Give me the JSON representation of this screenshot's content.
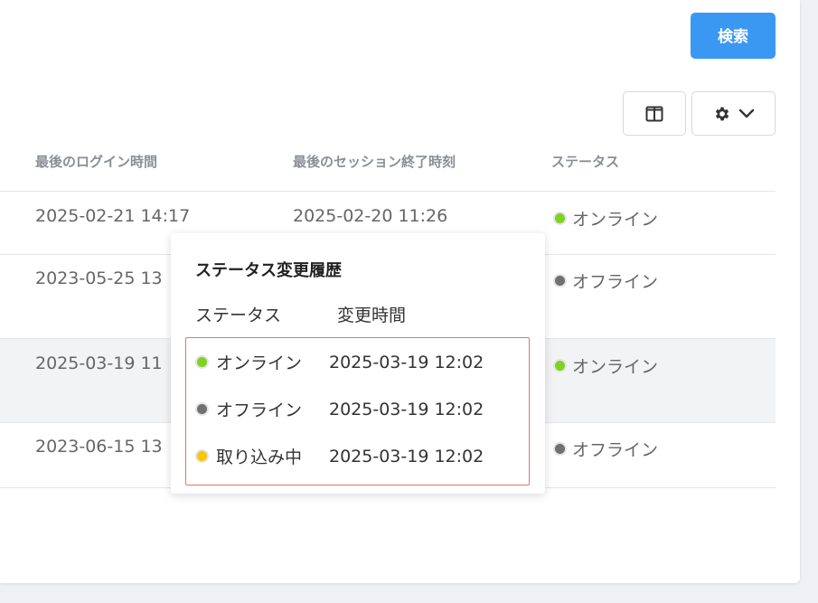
{
  "toolbar": {
    "search_label": "検索"
  },
  "table": {
    "headers": {
      "last_login": "最後のログイン時間",
      "last_session_end": "最後のセッション終了時刻",
      "status": "ステータス"
    },
    "rows": [
      {
        "last_login": "2025-02-21 14:17",
        "last_session_end": "2025-02-20 11:26",
        "status": "オンライン",
        "status_kind": "online"
      },
      {
        "last_login": "2023-05-25 13",
        "last_session_end": "",
        "status": "オフライン",
        "status_kind": "offline"
      },
      {
        "last_login": "2025-03-19 11",
        "last_session_end": "",
        "status": "オンライン",
        "status_kind": "online"
      },
      {
        "last_login": "2023-06-15 13",
        "last_session_end": "",
        "status": "オフライン",
        "status_kind": "offline"
      }
    ]
  },
  "popover": {
    "title": "ステータス変更履歴",
    "headers": {
      "status": "ステータス",
      "time": "変更時間"
    },
    "rows": [
      {
        "status": "オンライン",
        "time": "2025-03-19 12:02",
        "status_kind": "online"
      },
      {
        "status": "オフライン",
        "time": "2025-03-19 12:02",
        "status_kind": "offline"
      },
      {
        "status": "取り込み中",
        "time": "2025-03-19 12:02",
        "status_kind": "importing"
      }
    ]
  },
  "colors": {
    "accent": "#3a98f2",
    "online": "#7ed321",
    "offline": "#707070",
    "importing": "#f5c800",
    "highlight_border": "#e57373"
  },
  "icons": {
    "columns_button": "columns-icon",
    "settings_button": "gear-icon",
    "settings_dropdown": "chevron-down-icon"
  }
}
